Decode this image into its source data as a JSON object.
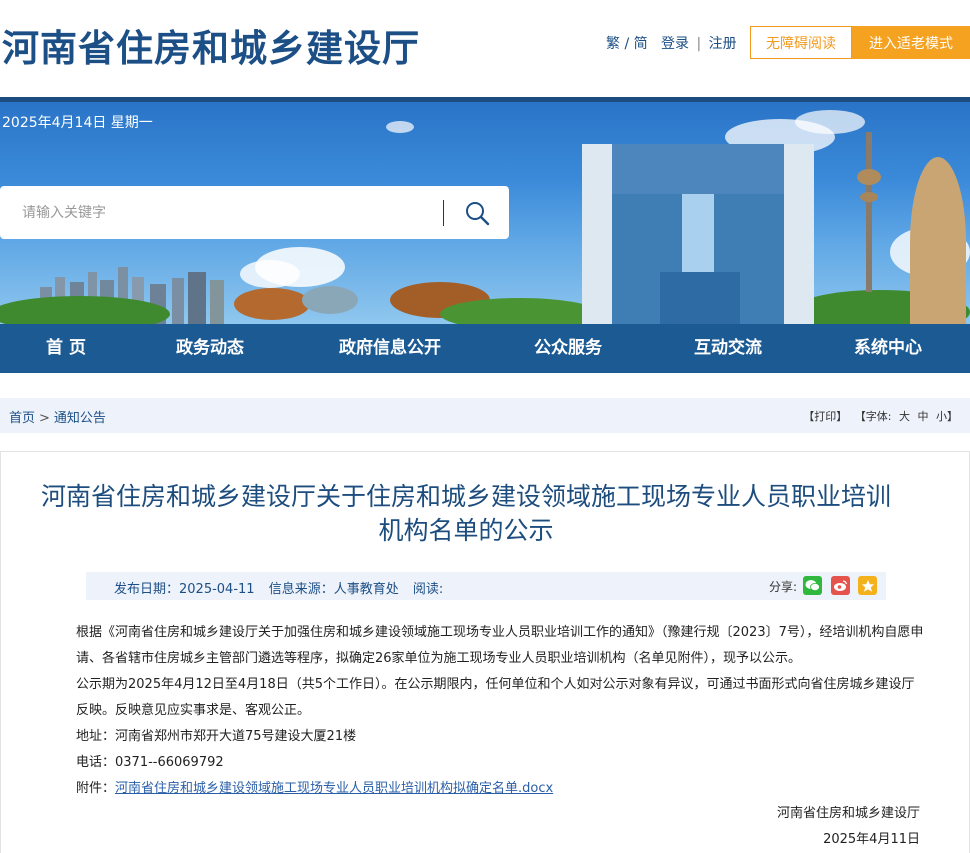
{
  "header": {
    "site_title": "河南省住房和城乡建设厅",
    "lang_toggle": "繁 / 简",
    "login": "登录",
    "separator": "|",
    "register": "注册",
    "accessibility_button": "无障碍阅读",
    "elder_mode_button": "进入适老模式"
  },
  "banner": {
    "date": "2025年4月14日 星期一",
    "search_placeholder": "请输入关键字"
  },
  "nav": {
    "items": [
      "首 页",
      "政务动态",
      "政府信息公开",
      "公众服务",
      "互动交流",
      "系统中心"
    ]
  },
  "breadcrumb": {
    "home": "首页",
    "arrow": ">",
    "current": "通知公告"
  },
  "tools": {
    "print": "【打印】",
    "font_label": "【字体:",
    "font_large": "大",
    "font_medium": "中",
    "font_small": "小",
    "font_close": "】"
  },
  "article": {
    "title": "河南省住房和城乡建设厅关于住房和城乡建设领域施工现场专业人员职业培训机构名单的公示",
    "publish_date": "发布日期：2025-04-11",
    "source": "信息来源：人事教育处",
    "views": "阅读:",
    "share_label": "分享:",
    "paragraph1": "根据《河南省住房和城乡建设厅关于加强住房和城乡建设领域施工现场专业人员职业培训工作的通知》（豫建行规〔2023〕7号），经培训机构自愿申请、各省辖市住房城乡主管部门遴选等程序，拟确定26家单位为施工现场专业人员职业培训机构（名单见附件），现予以公示。",
    "paragraph2": "公示期为2025年4月12日至4月18日（共5个工作日）。在公示期限内，任何单位和个人如对公示对象有异议，可通过书面形式向省住房城乡建设厅反映。反映意见应实事求是、客观公正。",
    "address": "地址：河南省郑州市郑开大道75号建设大厦21楼",
    "phone": "电话：0371--66069792",
    "attachment_label": "附件：",
    "attachment_link": "河南省住房和城乡建设领域施工现场专业人员职业培训机构拟确定名单.docx",
    "signature": "河南省住房和城乡建设厅",
    "sign_date": "2025年4月11日"
  },
  "colors": {
    "brand_blue": "#1c4f86",
    "nav_blue": "#1c5a94",
    "accent_orange": "#f5a221"
  }
}
